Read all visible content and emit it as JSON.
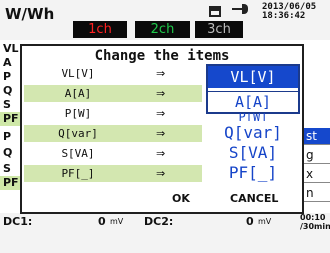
{
  "header": {
    "title": "W/Wh",
    "date": "2013/06/05",
    "time": "18:36:42",
    "channels": [
      "1ch",
      "2ch",
      "3ch"
    ]
  },
  "side_labels": [
    "VL",
    "A",
    "P",
    "Q",
    "S",
    "PF",
    "P",
    "Q",
    "S",
    "PF"
  ],
  "right_column": [
    "st",
    "g",
    "x",
    "n"
  ],
  "dialog": {
    "title": "Change the items",
    "rows": [
      {
        "label": "VL[V]",
        "arrow": "⇒"
      },
      {
        "label": "A[A]",
        "arrow": "⇒"
      },
      {
        "label": "P[W]",
        "arrow": "⇒"
      },
      {
        "label": "Q[var]",
        "arrow": "⇒"
      },
      {
        "label": "S[VA]",
        "arrow": "⇒"
      },
      {
        "label": "PF[_]",
        "arrow": "⇒"
      }
    ],
    "options": [
      "VL[V]",
      "A[A]",
      "P[W]",
      "Q[var]",
      "S[VA]",
      "PF[_]"
    ],
    "selected": "VL[V]",
    "ok_label": "OK",
    "cancel_label": "CANCEL"
  },
  "dc": {
    "dc1_label": "DC1:",
    "dc1_value": "0",
    "dc1_unit": "mV",
    "dc2_label": "DC2:",
    "dc2_value": "0",
    "dc2_unit": "mV",
    "interval_top": "00:10",
    "interval_bottom": "/30min"
  },
  "colors": {
    "accent": "#1548cc",
    "ch1": "#ff2020",
    "ch2": "#1ec84a",
    "row_highlight": "#d3e7b0"
  }
}
